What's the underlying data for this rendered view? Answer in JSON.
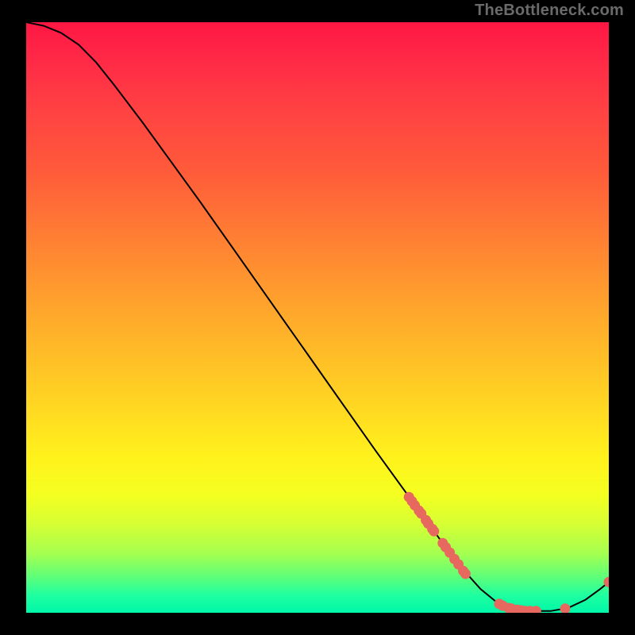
{
  "watermark": "TheBottleneck.com",
  "chart_data": {
    "type": "line",
    "title": "",
    "xlabel": "",
    "ylabel": "",
    "xlim": [
      0,
      1
    ],
    "ylim": [
      0,
      1
    ],
    "curve": [
      {
        "x": 0.0,
        "y": 1.0
      },
      {
        "x": 0.03,
        "y": 0.994
      },
      {
        "x": 0.06,
        "y": 0.982
      },
      {
        "x": 0.09,
        "y": 0.962
      },
      {
        "x": 0.12,
        "y": 0.932
      },
      {
        "x": 0.15,
        "y": 0.895
      },
      {
        "x": 0.2,
        "y": 0.83
      },
      {
        "x": 0.25,
        "y": 0.762
      },
      {
        "x": 0.3,
        "y": 0.694
      },
      {
        "x": 0.35,
        "y": 0.624
      },
      {
        "x": 0.4,
        "y": 0.554
      },
      {
        "x": 0.45,
        "y": 0.484
      },
      {
        "x": 0.5,
        "y": 0.414
      },
      {
        "x": 0.55,
        "y": 0.344
      },
      {
        "x": 0.6,
        "y": 0.274
      },
      {
        "x": 0.65,
        "y": 0.206
      },
      {
        "x": 0.7,
        "y": 0.138
      },
      {
        "x": 0.74,
        "y": 0.084
      },
      {
        "x": 0.78,
        "y": 0.04
      },
      {
        "x": 0.81,
        "y": 0.016
      },
      {
        "x": 0.84,
        "y": 0.005
      },
      {
        "x": 0.87,
        "y": 0.003
      },
      {
        "x": 0.9,
        "y": 0.003
      },
      {
        "x": 0.93,
        "y": 0.008
      },
      {
        "x": 0.96,
        "y": 0.022
      },
      {
        "x": 0.985,
        "y": 0.04
      },
      {
        "x": 1.0,
        "y": 0.052
      }
    ],
    "markers": [
      {
        "x": 0.657,
        "y": 0.196
      },
      {
        "x": 0.662,
        "y": 0.189
      },
      {
        "x": 0.667,
        "y": 0.182
      },
      {
        "x": 0.674,
        "y": 0.173
      },
      {
        "x": 0.678,
        "y": 0.168
      },
      {
        "x": 0.686,
        "y": 0.157
      },
      {
        "x": 0.69,
        "y": 0.151
      },
      {
        "x": 0.697,
        "y": 0.142
      },
      {
        "x": 0.7,
        "y": 0.138
      },
      {
        "x": 0.715,
        "y": 0.118
      },
      {
        "x": 0.72,
        "y": 0.111
      },
      {
        "x": 0.727,
        "y": 0.102
      },
      {
        "x": 0.735,
        "y": 0.091
      },
      {
        "x": 0.742,
        "y": 0.082
      },
      {
        "x": 0.75,
        "y": 0.071
      },
      {
        "x": 0.754,
        "y": 0.066
      },
      {
        "x": 0.812,
        "y": 0.015
      },
      {
        "x": 0.818,
        "y": 0.012
      },
      {
        "x": 0.828,
        "y": 0.008
      },
      {
        "x": 0.833,
        "y": 0.007
      },
      {
        "x": 0.843,
        "y": 0.005
      },
      {
        "x": 0.85,
        "y": 0.004
      },
      {
        "x": 0.857,
        "y": 0.003
      },
      {
        "x": 0.865,
        "y": 0.003
      },
      {
        "x": 0.875,
        "y": 0.003
      },
      {
        "x": 0.925,
        "y": 0.007
      },
      {
        "x": 1.0,
        "y": 0.052
      }
    ],
    "marker_color": "#e7685e",
    "curve_color": "#000000",
    "gradient_stops": [
      {
        "pos": 0.0,
        "color": "#ff1744"
      },
      {
        "pos": 0.74,
        "color": "#fff31c"
      },
      {
        "pos": 1.0,
        "color": "#00f7a9"
      }
    ]
  }
}
